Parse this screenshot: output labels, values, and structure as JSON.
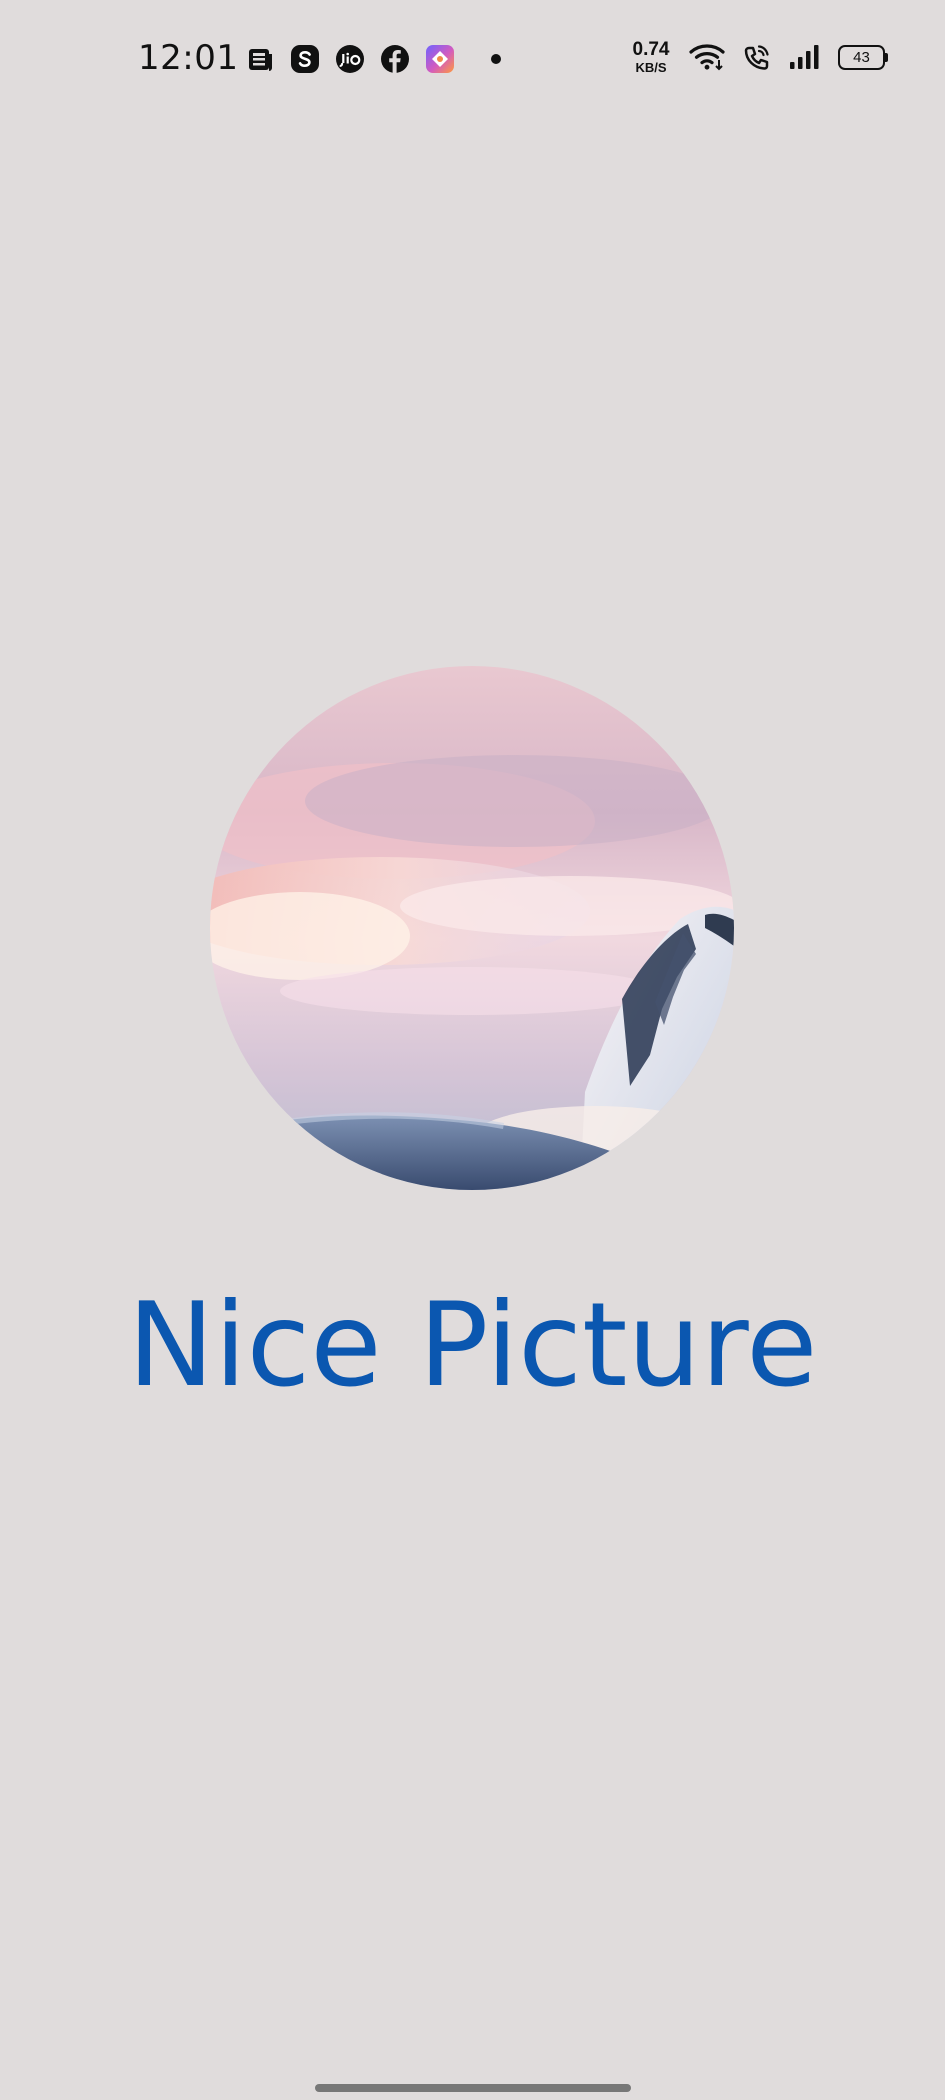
{
  "status_bar": {
    "time": "12:01",
    "notification_icons": [
      "news-icon",
      "skype-icon",
      "jio-icon",
      "facebook-icon",
      "colorful-app-icon",
      "dot-icon"
    ],
    "network_speed": "0.74",
    "network_speed_unit": "KB/S",
    "battery_level": "43"
  },
  "splash": {
    "title": "Nice Picture",
    "title_color": "#0b57b0",
    "background_color": "#e0dcdc"
  },
  "navigation": {
    "gesture_bar": "home-indicator"
  }
}
